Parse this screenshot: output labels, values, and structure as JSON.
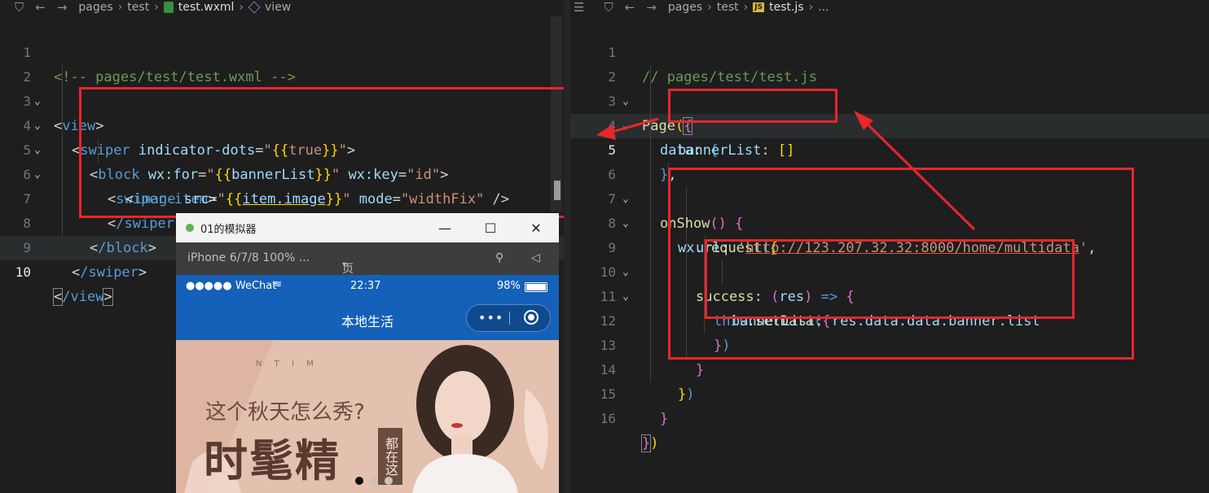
{
  "left_editor": {
    "breadcrumb": [
      "pages",
      "test",
      "test.wxml",
      "view"
    ],
    "lines": [
      {
        "n": "1"
      },
      {
        "n": "2"
      },
      {
        "n": "3"
      },
      {
        "n": "4"
      },
      {
        "n": "5"
      },
      {
        "n": "6"
      },
      {
        "n": "7"
      },
      {
        "n": "8"
      },
      {
        "n": "9"
      },
      {
        "n": "10"
      }
    ],
    "code": {
      "l1": "<!-- pages/test/test.wxml -->",
      "l2_open": "<",
      "l2_tag": "view",
      "l2_close": ">",
      "l3_tag": "swiper",
      "l3_attr": "indicator-dots",
      "l3_val_open": "\"",
      "l3_val_inner": "true",
      "l4_tag": "block",
      "l4_attr1": "wx:for",
      "l4_val1": "bannerList",
      "l4_attr2": "wx:key",
      "l4_val2": "\"id\"",
      "l5_tag": "swiper-item",
      "l6_tag": "image",
      "l6_attr1": "src",
      "l6_val1": "item.image",
      "l6_attr2": "mode",
      "l6_val2": "\"widthFix\"",
      "l7_tag": "/swiper-item",
      "l8_tag": "/block",
      "l9_tag": "/swiper",
      "l10_tag": "/view"
    }
  },
  "right_editor": {
    "breadcrumb": [
      "pages",
      "test",
      "test.js",
      "..."
    ],
    "lines": [
      {
        "n": "1"
      },
      {
        "n": "2"
      },
      {
        "n": "3"
      },
      {
        "n": "4"
      },
      {
        "n": "5"
      },
      {
        "n": "6"
      },
      {
        "n": "7"
      },
      {
        "n": "8"
      },
      {
        "n": "9"
      },
      {
        "n": "10"
      },
      {
        "n": "11"
      },
      {
        "n": "12"
      },
      {
        "n": "13"
      },
      {
        "n": "14"
      },
      {
        "n": "15"
      },
      {
        "n": "16"
      }
    ],
    "code": {
      "l1": "// pages/test/test.js",
      "l2_fn": "Page",
      "l3_prop": "data",
      "l4_prop": "bannerList",
      "l4_val": "[]",
      "l6_fn": "onShow",
      "l7_obj": "wx",
      "l7_fn": "request",
      "l8_prop": "url",
      "l8_url": "http://123.207.32.32:8000/home/multidata",
      "l9_prop": "success",
      "l9_param": "res",
      "l10_kw": "this",
      "l10_fn": "setData",
      "l11_prop": "bannerList",
      "l11_val": "res.data.data.banner.list"
    }
  },
  "simulator": {
    "window_title": "01的模拟器",
    "device": "iPhone 6/7/8 100% ...",
    "page_info": "页面信息",
    "status_left": "●●●●● WeChat",
    "time": "22:37",
    "battery": "98%",
    "nav_title": "本地生活",
    "banner": {
      "letters": "N  T  I  M",
      "headline": "这个秋天怎么秀?",
      "big_text": "时髦精",
      "side_text": "都在这"
    }
  },
  "colors": {
    "editor_bg": "#1e1e1e",
    "highlight_red": "#e8262c",
    "wechat_blue": "#1560b8"
  }
}
